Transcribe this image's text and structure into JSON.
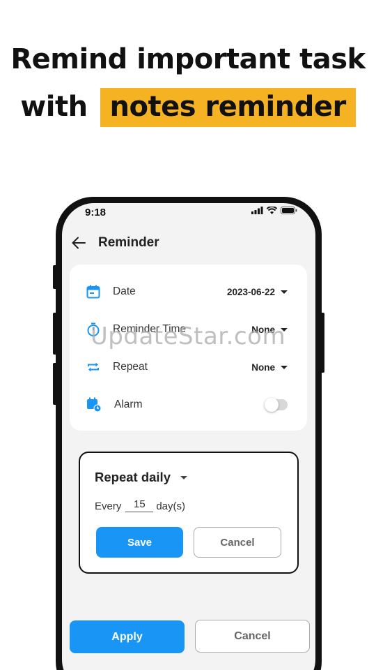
{
  "headline": {
    "line1": "Remind important task",
    "line2_plain": "with",
    "line2_highlight": "notes reminder"
  },
  "status_bar": {
    "time": "9:18"
  },
  "header": {
    "title": "Reminder"
  },
  "reminder_settings": {
    "date": {
      "label": "Date",
      "value": "2023-06-22"
    },
    "reminder_time": {
      "label": "Reminder Time",
      "value": "None"
    },
    "repeat": {
      "label": "Repeat",
      "value": "None"
    },
    "alarm": {
      "label": "Alarm",
      "enabled": false
    }
  },
  "repeat_dialog": {
    "mode": "Repeat daily",
    "every_prefix": "Every",
    "every_value": "15",
    "every_suffix": "day(s)",
    "save_label": "Save",
    "cancel_label": "Cancel"
  },
  "footer": {
    "apply_label": "Apply",
    "cancel_label": "Cancel"
  },
  "watermark": "UpdateStar.com",
  "colors": {
    "accent": "#1996f5",
    "highlight": "#f5b324"
  }
}
